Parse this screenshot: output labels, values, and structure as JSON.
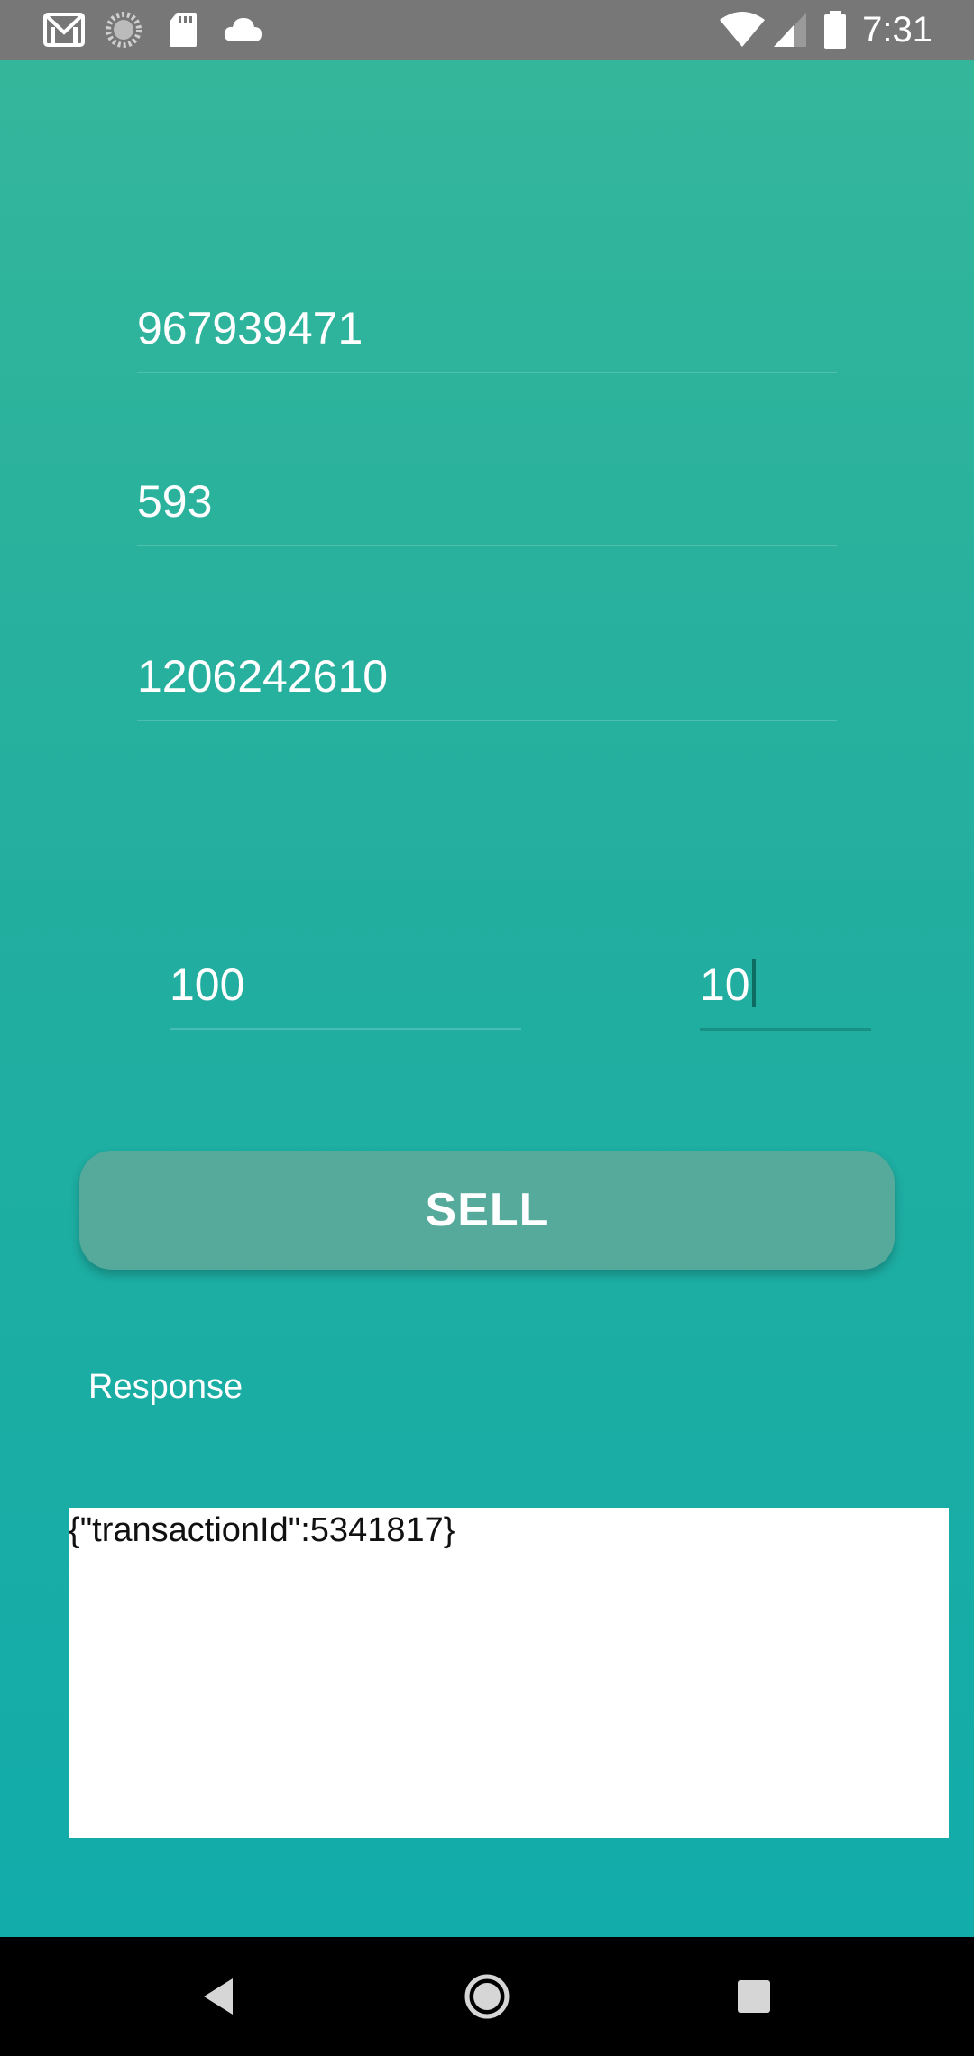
{
  "status_bar": {
    "time": "7:31",
    "left_icons": [
      "gmail-icon",
      "sync-progress-icon",
      "sd-card-icon",
      "cloud-icon"
    ],
    "right_icons": [
      "wifi-icon",
      "signal-icon",
      "battery-icon"
    ]
  },
  "form": {
    "field_1_value": "967939471",
    "field_2_value": "593",
    "field_3_value": "1206242610",
    "amount_value": "100",
    "quantity_value": "10"
  },
  "sell_button_label": "SELL",
  "response": {
    "label": "Response",
    "body": "{\"transactionId\":5341817}"
  },
  "nav_bar": {
    "buttons": [
      "back-icon",
      "home-icon",
      "recents-icon"
    ]
  },
  "colors": {
    "status_bar": "#777777",
    "gradient_top": "#34b69b",
    "gradient_bottom": "#12acaa",
    "button": "#55aa9b",
    "nav_bar": "#000000"
  }
}
